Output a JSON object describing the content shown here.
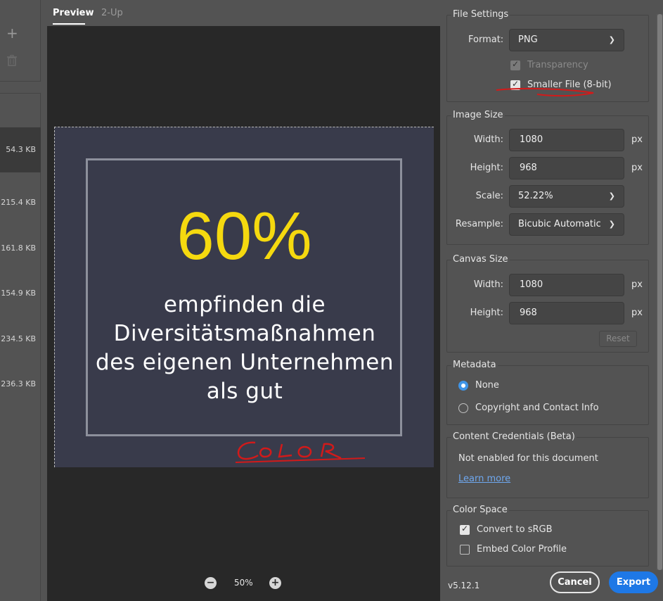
{
  "sidebar": {
    "sizes": [
      "54.3 KB",
      "215.4 KB",
      "161.8 KB",
      "154.9 KB",
      "234.5 KB",
      "236.3 KB"
    ]
  },
  "tabs": {
    "preview": "Preview",
    "two_up": "2-Up"
  },
  "canvas": {
    "percent": "60%",
    "lines": [
      "empfinden die",
      "Diversitätsmaßnahmen",
      "des eigenen Unternehmen",
      "als gut"
    ],
    "annotation": "COLOR",
    "bg_color": "#393b4b",
    "accent_color": "#f5d90f"
  },
  "zoom": {
    "value": "50%"
  },
  "file_settings": {
    "title": "File Settings",
    "format_label": "Format:",
    "format_value": "PNG",
    "transparency_label": "Transparency",
    "transparency_checked": true,
    "transparency_disabled": true,
    "smaller_file_label": "Smaller File (8-bit)",
    "smaller_file_checked": true
  },
  "image_size": {
    "title": "Image Size",
    "width_label": "Width:",
    "width_value": "1080",
    "height_label": "Height:",
    "height_value": "968",
    "unit": "px",
    "scale_label": "Scale:",
    "scale_value": "52.22%",
    "resample_label": "Resample:",
    "resample_value": "Bicubic Automatic"
  },
  "canvas_size": {
    "title": "Canvas Size",
    "width_label": "Width:",
    "width_value": "1080",
    "height_label": "Height:",
    "height_value": "968",
    "unit": "px",
    "reset_label": "Reset"
  },
  "metadata": {
    "title": "Metadata",
    "options": [
      "None",
      "Copyright and Contact Info"
    ],
    "selected": "None"
  },
  "content_credentials": {
    "title": "Content Credentials (Beta)",
    "status": "Not enabled for this document",
    "link": "Learn more"
  },
  "color_space": {
    "title": "Color Space",
    "convert_label": "Convert to sRGB",
    "convert_checked": true,
    "embed_label": "Embed Color Profile",
    "embed_checked": false
  },
  "footer": {
    "version": "v5.12.1",
    "cancel_label": "Cancel",
    "export_label": "Export",
    "export_color": "#1e78e6"
  }
}
